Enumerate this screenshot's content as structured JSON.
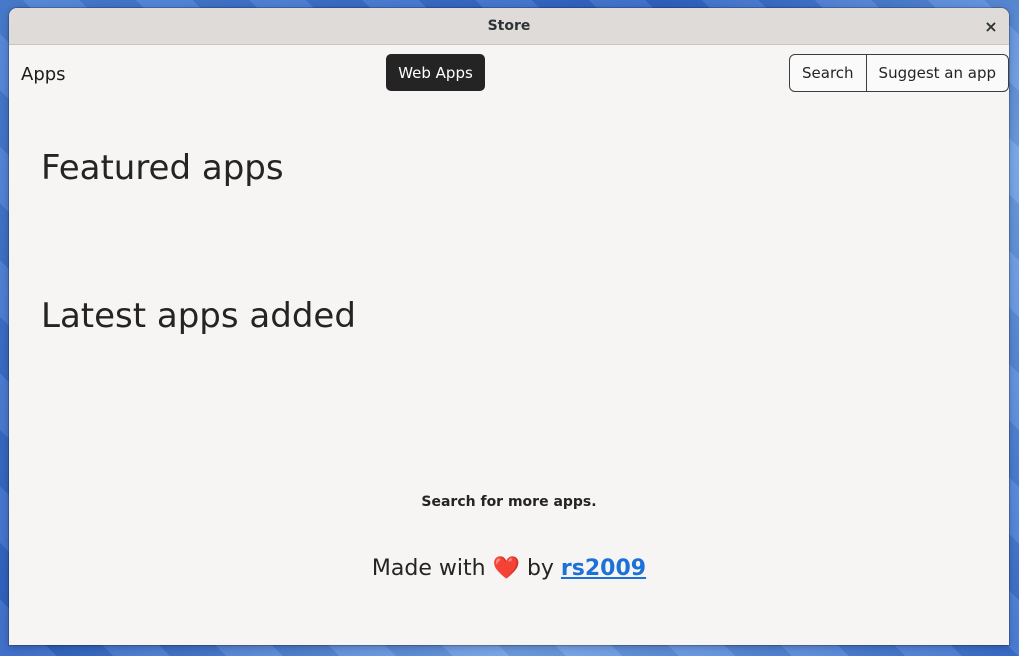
{
  "window": {
    "title": "Store",
    "close_symbol": "×"
  },
  "header": {
    "app_name": "Apps",
    "nav_web_apps": "Web Apps",
    "search_label": "Search",
    "suggest_label": "Suggest an app"
  },
  "main": {
    "featured_heading": "Featured apps",
    "latest_heading": "Latest apps added",
    "search_more": "Search for more apps."
  },
  "footer": {
    "made_with": "Made with",
    "heart": "❤️",
    "by": "by",
    "author": "rs2009"
  },
  "colors": {
    "accent": "#1c71d8",
    "heart": "#e01b24",
    "nav_active_bg": "#242424"
  }
}
